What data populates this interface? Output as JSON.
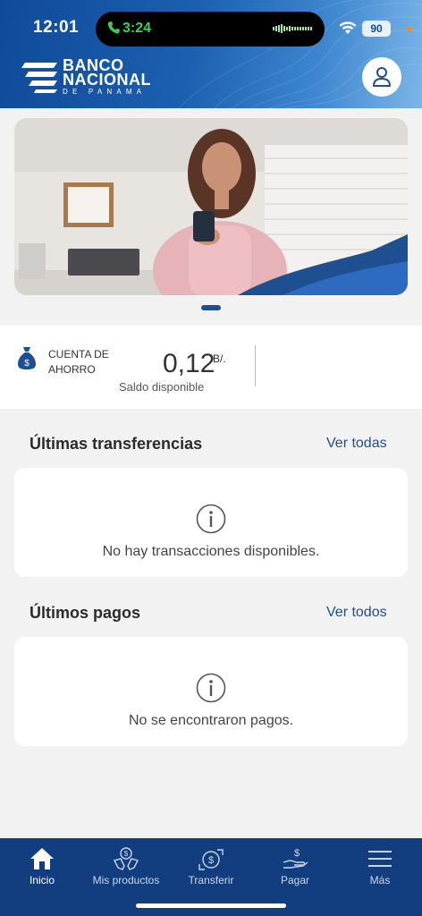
{
  "status_bar": {
    "time": "12:01",
    "call_time": "3:24",
    "battery": "90"
  },
  "brand": {
    "line1": "BANCO",
    "line2": "NACIONAL",
    "line3": "DE PANAMA"
  },
  "account": {
    "type": "CUENTA DE AHORRO",
    "balance": "0,12",
    "currency": "B/.",
    "balance_label": "Saldo disponible"
  },
  "transfers": {
    "title": "Últimas transferencias",
    "see_all": "Ver todas",
    "empty_message": "No hay transacciones disponibles."
  },
  "payments": {
    "title": "Últimos pagos",
    "see_all": "Ver todos",
    "empty_message": "No se encontraron pagos."
  },
  "nav": [
    {
      "label": "Inicio",
      "icon": "home-icon",
      "active": true
    },
    {
      "label": "Mis productos",
      "icon": "products-icon",
      "active": false
    },
    {
      "label": "Transferir",
      "icon": "transfer-icon",
      "active": false
    },
    {
      "label": "Pagar",
      "icon": "pay-icon",
      "active": false
    },
    {
      "label": "Más",
      "icon": "menu-icon",
      "active": false
    }
  ],
  "colors": {
    "brand_blue": "#123e7f",
    "accent_blue": "#1d4f91",
    "call_green": "#39d353"
  }
}
